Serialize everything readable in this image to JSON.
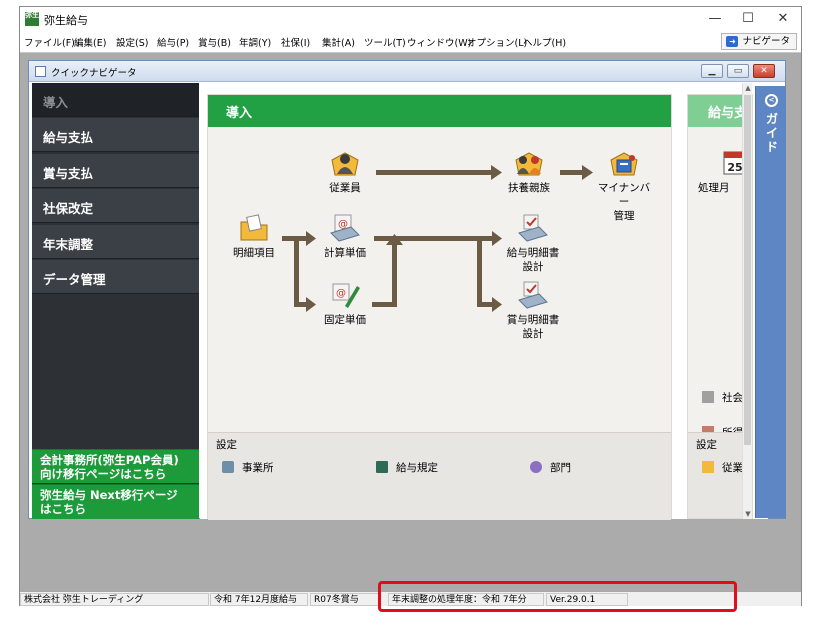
{
  "window": {
    "title": "弥生給与",
    "icon_text": "弥生",
    "minimize": "—",
    "maximize": "☐",
    "close": "✕"
  },
  "menu": [
    "ファイル(F)",
    "編集(E)",
    "設定(S)",
    "給与(P)",
    "賞与(B)",
    "年調(Y)",
    "社保(I)",
    "集計(A)",
    "ツール(T)",
    "ウィンドウ(W)",
    "オプション(L)",
    "ヘルプ(H)"
  ],
  "navigator_button": "ナビゲータ",
  "child": {
    "title": "クイックナビゲータ"
  },
  "sidebar": {
    "items": [
      "導入",
      "給与支払",
      "賞与支払",
      "社保改定",
      "年末調整",
      "データ管理"
    ],
    "links": [
      {
        "line1": "会計事務所(弥生PAP会員)",
        "line2": "向け移行ページはこちら"
      },
      {
        "line1": "弥生給与 Next移行ページ",
        "line2": "はこちら"
      }
    ]
  },
  "panel": {
    "title": "導入",
    "nodes": {
      "employee": "従業員",
      "dependents": "扶養親族",
      "mynumber_l1": "マイナンバー",
      "mynumber_l2": "管理",
      "detail": "明細項目",
      "calc_unit": "計算単価",
      "fixed_unit": "固定単価",
      "salary_slip_l1": "給与明細書",
      "salary_slip_l2": "設計",
      "bonus_slip_l1": "賞与明細書",
      "bonus_slip_l2": "設計"
    },
    "settings_label": "設定",
    "settings_items": [
      "事業所",
      "給与規定",
      "部門"
    ]
  },
  "panel2": {
    "title": "給与支払",
    "node": "処理月",
    "calendar_number": "25",
    "items": [
      "社会",
      "所得"
    ],
    "settings_label": "設定",
    "settings_item": "従業"
  },
  "guide": {
    "label": "ガイド"
  },
  "status": {
    "company": "株式会社 弥生トレーディング",
    "payroll": "令和 7年12月度給与",
    "bonus": "R07冬賞与",
    "year_end": "年末調整の処理年度：令和 7年分",
    "version": "Ver.29.0.1"
  },
  "colors": {
    "sidebar_bg": "#3b4046",
    "panel_green": "#21a143",
    "link_green": "#1d9a3a",
    "guide_blue": "#5f86c4",
    "arrow": "#6b5a44",
    "highlight_red": "#e10d1c"
  }
}
